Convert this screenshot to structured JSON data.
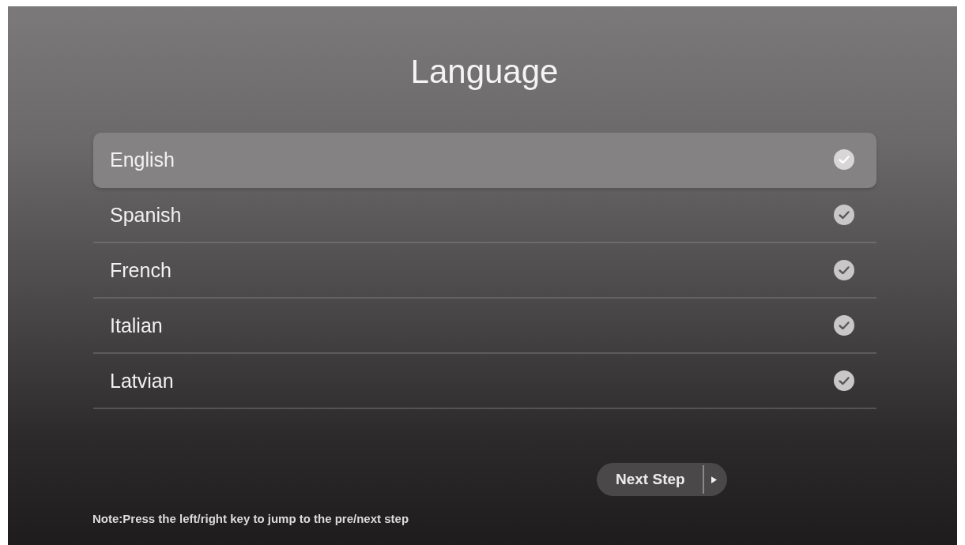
{
  "title": "Language",
  "languages": [
    {
      "label": "English",
      "selected": true
    },
    {
      "label": "Spanish",
      "selected": false
    },
    {
      "label": "French",
      "selected": false
    },
    {
      "label": "Italian",
      "selected": false
    },
    {
      "label": "Latvian",
      "selected": false
    }
  ],
  "next_button": {
    "label": "Next Step"
  },
  "note": "Note:Press the left/right key to jump to the pre/next step"
}
